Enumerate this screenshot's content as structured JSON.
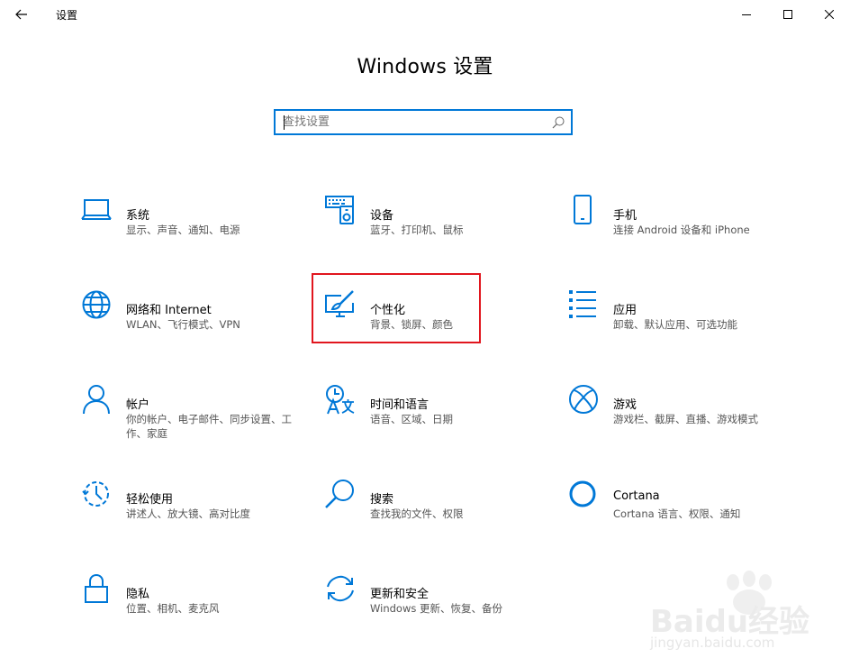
{
  "window": {
    "back_label": "返回",
    "title": "设置"
  },
  "page": {
    "heading": "Windows 设置"
  },
  "search": {
    "placeholder": "查找设置",
    "value": ""
  },
  "tiles": [
    {
      "name": "系统",
      "desc": "显示、声音、通知、电源",
      "icon": "laptop-icon"
    },
    {
      "name": "设备",
      "desc": "蓝牙、打印机、鼠标",
      "icon": "devices-icon"
    },
    {
      "name": "手机",
      "desc": "连接 Android 设备和 iPhone",
      "icon": "phone-icon"
    },
    {
      "name": "网络和 Internet",
      "desc": "WLAN、飞行模式、VPN",
      "icon": "globe-icon"
    },
    {
      "name": "个性化",
      "desc": "背景、锁屏、颜色",
      "icon": "personalization-icon"
    },
    {
      "name": "应用",
      "desc": "卸载、默认应用、可选功能",
      "icon": "apps-list-icon"
    },
    {
      "name": "帐户",
      "desc": "你的帐户、电子邮件、同步设置、工作、家庭",
      "icon": "person-icon"
    },
    {
      "name": "时间和语言",
      "desc": "语音、区域、日期",
      "icon": "time-language-icon"
    },
    {
      "name": "游戏",
      "desc": "游戏栏、截屏、直播、游戏模式",
      "icon": "xbox-icon"
    },
    {
      "name": "轻松使用",
      "desc": "讲述人、放大镜、高对比度",
      "icon": "ease-of-access-icon"
    },
    {
      "name": "搜索",
      "desc": "查找我的文件、权限",
      "icon": "search-icon"
    },
    {
      "name": "Cortana",
      "desc": "Cortana 语言、权限、通知",
      "icon": "cortana-icon"
    },
    {
      "name": "隐私",
      "desc": "位置、相机、麦克风",
      "icon": "lock-icon"
    },
    {
      "name": "更新和安全",
      "desc": "Windows 更新、恢复、备份",
      "icon": "update-icon"
    }
  ],
  "watermark": {
    "brand": "Baidu经验",
    "url": "jingyan.baidu.com"
  },
  "colors": {
    "accent": "#0078d7",
    "highlight": "#e1161e"
  }
}
